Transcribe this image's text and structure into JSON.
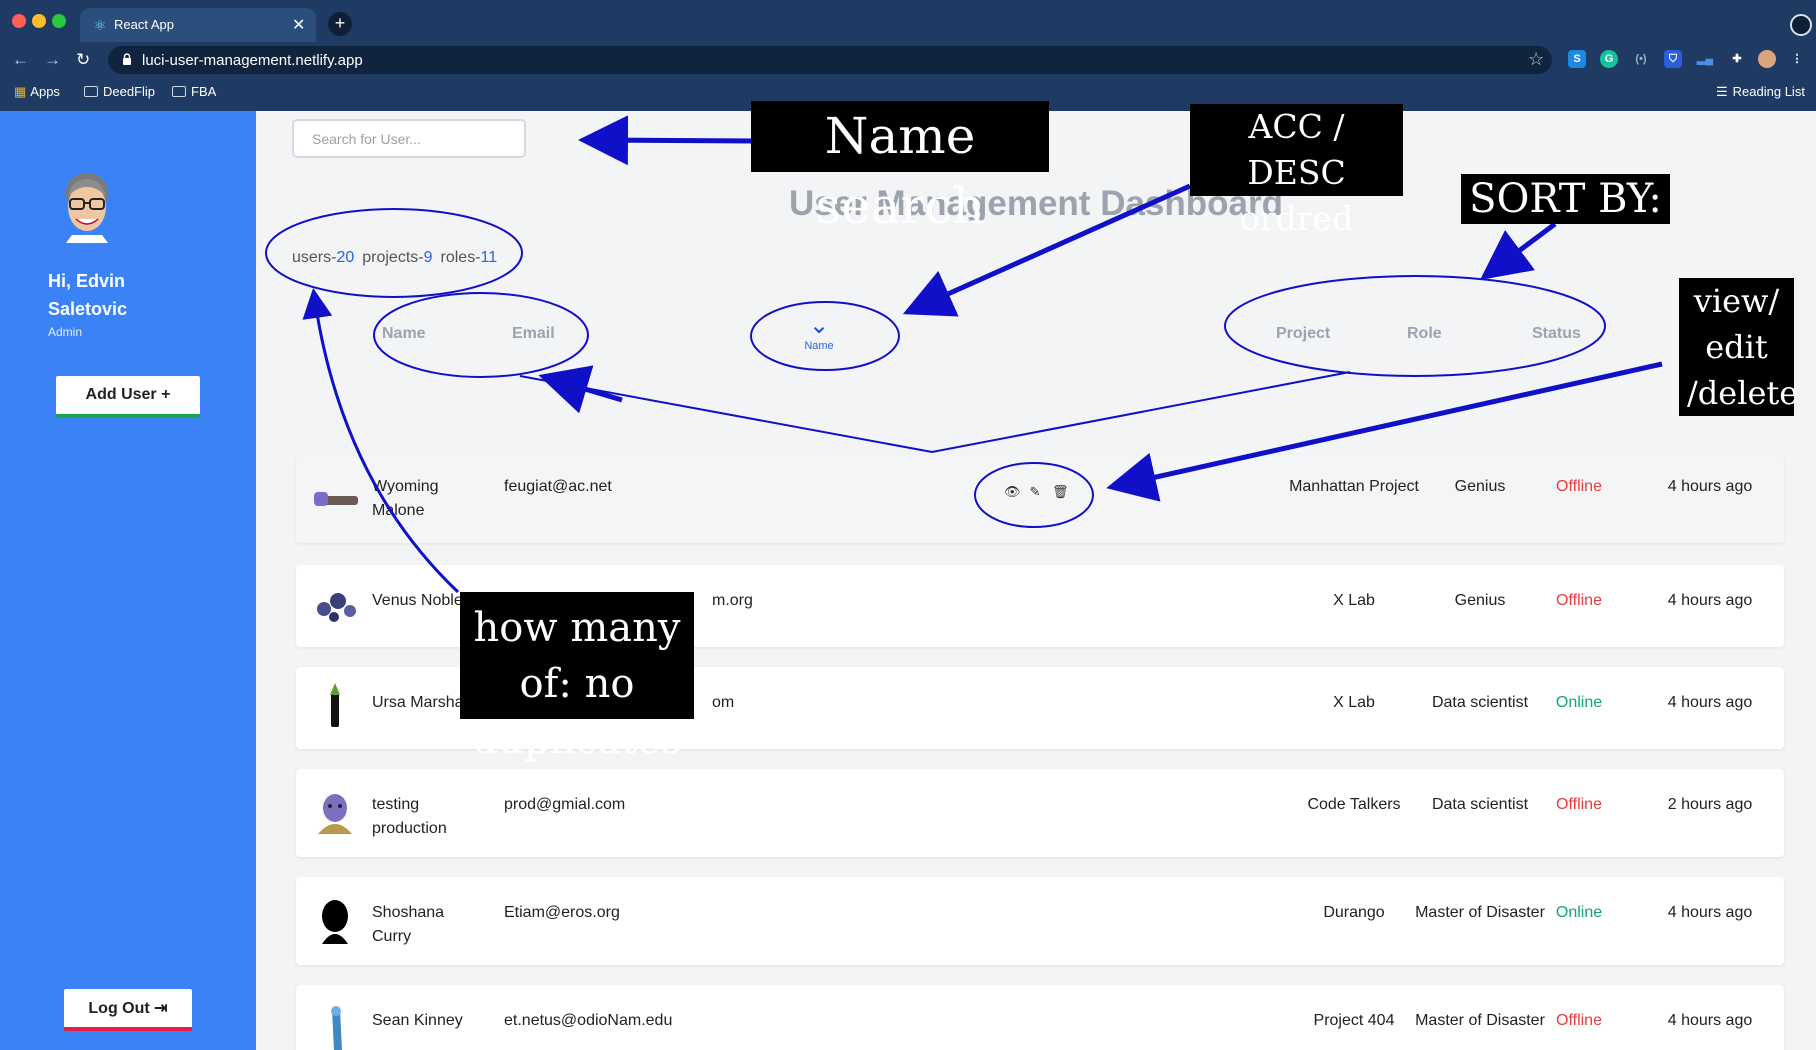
{
  "browser": {
    "tab_title": "React App",
    "url": "luci-user-management.netlify.app",
    "bookmarks": [
      "Apps",
      "DeedFlip",
      "FBA"
    ],
    "reading_list": "Reading List"
  },
  "sidebar": {
    "greeting": "Hi, Edvin Saletovic",
    "role": "Admin",
    "add_user": "Add User +",
    "logout": "Log Out"
  },
  "search": {
    "placeholder": "Search for User..."
  },
  "dashboard": {
    "title": "User Management Dashboard",
    "stats": {
      "users_label": "users-",
      "users": "20",
      "projects_label": "projects-",
      "projects": "9",
      "roles_label": "roles-",
      "roles": "11"
    },
    "columns": {
      "name": "Name",
      "email": "Email",
      "sort_label": "Name",
      "project": "Project",
      "role": "Role",
      "status": "Status"
    }
  },
  "users": [
    {
      "name": "Wyoming Malone",
      "email": "feugiat@ac.net",
      "project": "Manhattan Project",
      "role": "Genius",
      "status": "Offline",
      "time": "4 hours ago"
    },
    {
      "name": "Venus Noble",
      "email": "m.org",
      "project": "X Lab",
      "role": "Genius",
      "status": "Offline",
      "time": "4 hours ago"
    },
    {
      "name": "Ursa Marsha",
      "email": "om",
      "project": "X Lab",
      "role": "Data scientist",
      "status": "Online",
      "time": "4 hours ago"
    },
    {
      "name": "testing production",
      "email": "prod@gmial.com",
      "project": "Code Talkers",
      "role": "Data scientist",
      "status": "Offline",
      "time": "2 hours ago"
    },
    {
      "name": "Shoshana Curry",
      "email": "Etiam@eros.org",
      "project": "Durango",
      "role": "Master of Disaster",
      "status": "Online",
      "time": "4 hours ago"
    },
    {
      "name": "Sean Kinney",
      "email": "et.netus@odioNam.edu",
      "project": "Project 404",
      "role": "Master of Disaster",
      "status": "Offline",
      "time": "4 hours ago"
    }
  ],
  "annotations": {
    "name_search": "Name search",
    "sort_order": "ACC / DESC ordred",
    "sort_by": "SORT BY:",
    "actions": "view/ edit /delete",
    "counts": "how many of: no duplicates"
  },
  "colors": {
    "sidebar": "#3b82f6",
    "online": "#16a37a",
    "offline": "#e53e3e",
    "accent": "#2563eb",
    "annotation": "#1010c8"
  }
}
